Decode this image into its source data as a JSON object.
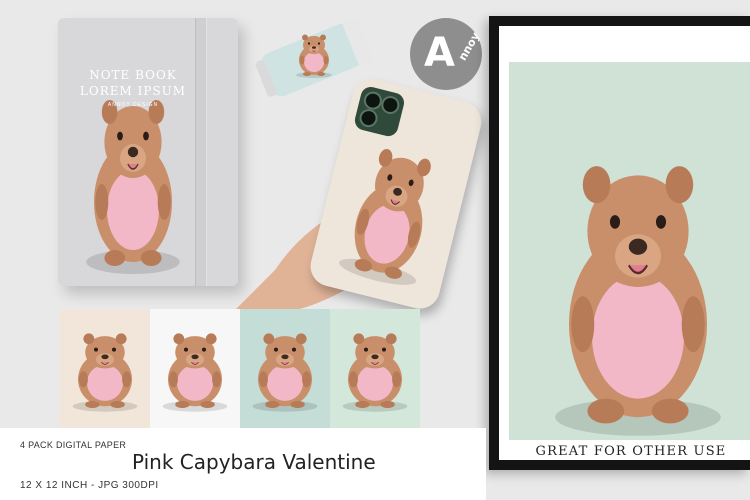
{
  "notebook": {
    "title_line1": "NOTE BOOK",
    "title_line2": "LOREM IPSUM",
    "subtitle": "ANNOY DESIGN"
  },
  "logo": {
    "icon": "annoy-logo",
    "text": "nnoy"
  },
  "poster": {
    "caption": "GREAT FOR OTHER USE"
  },
  "footer": {
    "pack_label": "4 PACK DIGITAL PAPER",
    "product_title": "Pink Capybara Valentine",
    "specs": "12 X 12 INCH - JPG 300DPI"
  },
  "tiles": [
    {
      "name": "tile-cream",
      "bg": "#f1e6d9"
    },
    {
      "name": "tile-white",
      "bg": "#f7f7f7"
    },
    {
      "name": "tile-mint",
      "bg": "#c4ddd6"
    },
    {
      "name": "tile-green",
      "bg": "#d3e7da"
    }
  ],
  "colors": {
    "capybara_body": "#c98f6b",
    "capybara_belly": "#f3b8c8",
    "poster_bg": "#cfe2d5",
    "frame": "#141414"
  }
}
